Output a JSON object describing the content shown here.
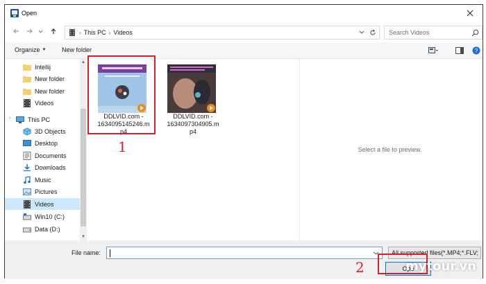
{
  "window": {
    "title": "Open"
  },
  "address": {
    "crumbs": [
      "This PC",
      "Videos"
    ]
  },
  "search": {
    "placeholder": "Search Videos"
  },
  "toolbar": {
    "organize_label": "Organize",
    "new_folder_label": "New folder"
  },
  "sidebar": {
    "items": [
      {
        "label": "Intellij",
        "icon": "folder-icon"
      },
      {
        "label": "New folder",
        "icon": "folder-icon"
      },
      {
        "label": "New folder",
        "icon": "folder-icon"
      },
      {
        "label": "Videos",
        "icon": "videos-folder-icon"
      },
      {
        "label": "This PC",
        "icon": "computer-icon"
      },
      {
        "label": "3D Objects",
        "icon": "3d-objects-icon"
      },
      {
        "label": "Desktop",
        "icon": "desktop-icon"
      },
      {
        "label": "Documents",
        "icon": "documents-icon"
      },
      {
        "label": "Downloads",
        "icon": "downloads-icon"
      },
      {
        "label": "Music",
        "icon": "music-icon"
      },
      {
        "label": "Pictures",
        "icon": "pictures-icon"
      },
      {
        "label": "Videos",
        "icon": "videos-folder-icon",
        "selected": true
      },
      {
        "label": "Win10 (C:)",
        "icon": "drive-icon"
      },
      {
        "label": "Data (D:)",
        "icon": "drive-icon"
      }
    ]
  },
  "files": [
    {
      "name_line1": "DDLVID.com -",
      "name_line2": "1634095145246.m",
      "name_line3": "p4"
    },
    {
      "name_line1": "DDLVID.com -",
      "name_line2": "1634097304905.m",
      "name_line3": "p4"
    }
  ],
  "preview": {
    "message": "Select a file to preview."
  },
  "bottom": {
    "file_name_label": "File name:",
    "file_name_value": "",
    "file_type_value": "All supported files(*.MP4;*.FLV;",
    "open_label": "Ope"
  },
  "annotations": {
    "step1": "1",
    "step2": "2"
  },
  "watermark": {
    "text": "mytour.vn"
  },
  "colors": {
    "annotation_red": "#d0202e",
    "selection_blue": "#cce8ff",
    "accent_blue": "#0078d7"
  }
}
